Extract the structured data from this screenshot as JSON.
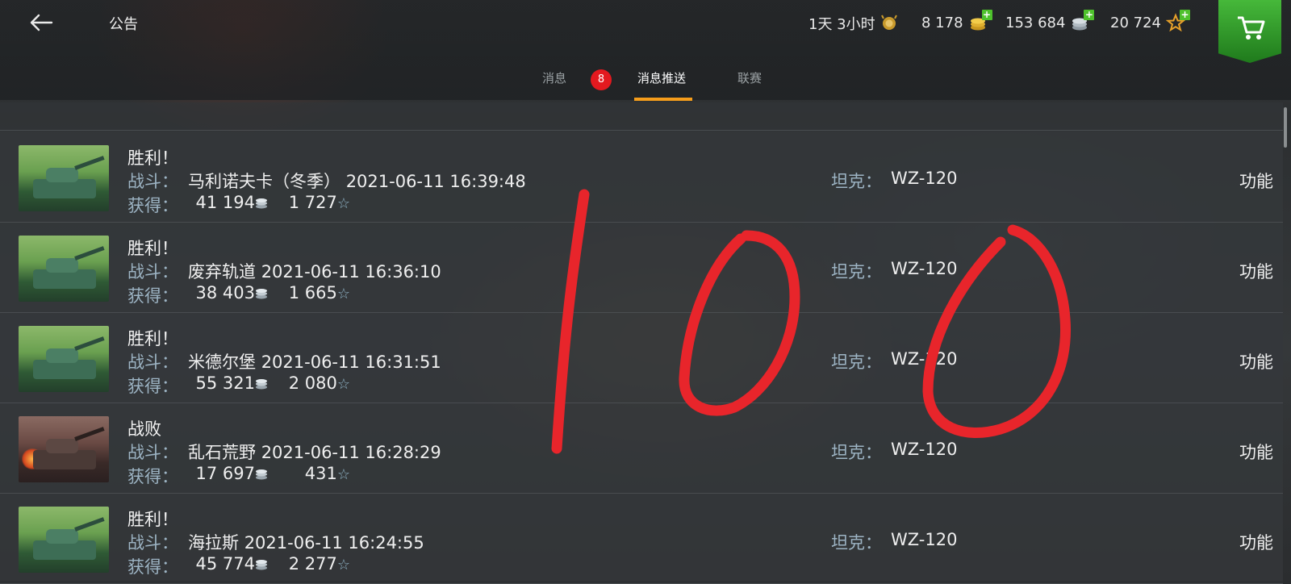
{
  "header": {
    "title": "公告",
    "timer": "1天 3小时",
    "gold": "8 178",
    "silver": "153 684",
    "free_xp": "20 724"
  },
  "tabs": [
    {
      "label": "消息"
    },
    {
      "label": "消息推送",
      "active": true
    },
    {
      "label": "联赛"
    }
  ],
  "badge_count": "8",
  "labels": {
    "battle": "战斗：",
    "earned": "获得：",
    "tank": "坦克：",
    "function": "功能"
  },
  "rows": [
    {
      "result": "胜利！",
      "map": "马利诺夫卡（冬季）",
      "datetime": "2021-06-11 16:39:48",
      "silver": "41 194",
      "xp": "1 727",
      "tank": "WZ-120",
      "outcome": "win"
    },
    {
      "result": "胜利！",
      "map": "废弃轨道",
      "datetime": "2021-06-11 16:36:10",
      "silver": "38 403",
      "xp": "1 665",
      "tank": "WZ-120",
      "outcome": "win"
    },
    {
      "result": "胜利！",
      "map": "米德尔堡",
      "datetime": "2021-06-11 16:31:51",
      "silver": "55 321",
      "xp": "2 080",
      "tank": "WZ-120",
      "outcome": "win"
    },
    {
      "result": "战败",
      "map": "乱石荒野",
      "datetime": "2021-06-11 16:28:29",
      "silver": "17 697",
      "xp": "431",
      "tank": "WZ-120",
      "outcome": "loss"
    },
    {
      "result": "胜利！",
      "map": "海拉斯",
      "datetime": "2021-06-11 16:24:55",
      "silver": "45 774",
      "xp": "2 277",
      "tank": "WZ-120",
      "outcome": "win"
    }
  ],
  "colors": {
    "accent": "#f59d1b",
    "badge": "#e3191f",
    "label_blue": "#9db4c4",
    "annotation": "#e8252b",
    "cart_green": "#2e9a2a"
  },
  "icons": [
    "back-arrow-icon",
    "rank-medal-icon",
    "gold-coins-icon",
    "silver-coins-icon",
    "free-xp-star-icon",
    "cart-icon"
  ]
}
